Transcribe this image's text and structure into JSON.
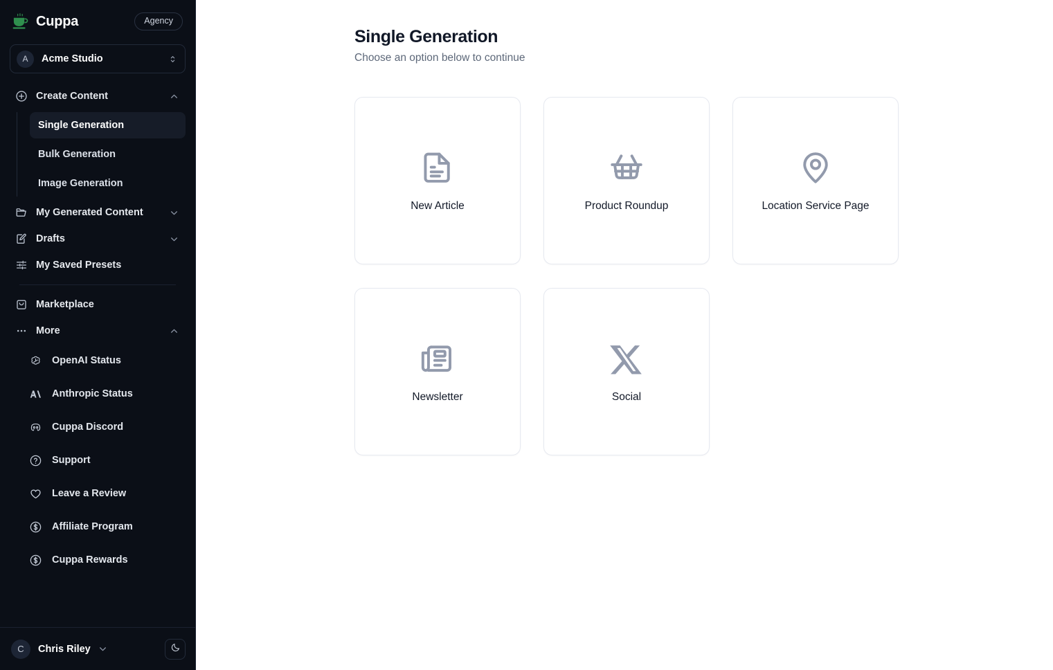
{
  "sidebar": {
    "brand": {
      "name": "Cuppa",
      "logo_icon": "coffee-cup-icon",
      "badge": "Agency",
      "accent": "#2f8f4e"
    },
    "workspace": {
      "initial": "A",
      "name": "Acme Studio",
      "chevron_icon": "chevron-up-down-icon"
    },
    "nav": [
      {
        "label": "Create Content",
        "icon": "plus-circle-icon",
        "chevron": "chevron-up-icon",
        "expanded": true,
        "children": [
          {
            "label": "Single Generation",
            "active": true
          },
          {
            "label": "Bulk Generation",
            "active": false
          },
          {
            "label": "Image Generation",
            "active": false
          }
        ]
      },
      {
        "label": "My Generated Content",
        "icon": "folder-icon",
        "chevron": "chevron-down-icon",
        "expanded": false
      },
      {
        "label": "Drafts",
        "icon": "pencil-square-icon",
        "chevron": "chevron-down-icon",
        "expanded": false
      },
      {
        "label": "My Saved Presets",
        "icon": "sliders-icon",
        "chevron": "",
        "expanded": false
      }
    ],
    "nav_after_divider": [
      {
        "label": "Marketplace",
        "icon": "shopping-bag-icon",
        "chevron": "",
        "expanded": false
      },
      {
        "label": "More",
        "icon": "ellipsis-icon",
        "chevron": "chevron-up-icon",
        "expanded": true
      }
    ],
    "more_items": [
      {
        "label": "OpenAI Status",
        "icon": "openai-icon"
      },
      {
        "label": "Anthropic Status",
        "icon": "anthropic-icon"
      },
      {
        "label": "Cuppa Discord",
        "icon": "discord-icon"
      },
      {
        "label": "Support",
        "icon": "question-circle-icon"
      },
      {
        "label": "Leave a Review",
        "icon": "heart-icon"
      },
      {
        "label": "Affiliate Program",
        "icon": "dollar-circle-icon"
      },
      {
        "label": "Cuppa Rewards",
        "icon": "dollar-circle-icon"
      }
    ],
    "footer": {
      "initial": "C",
      "name": "Chris Riley",
      "chevron_icon": "chevron-down-icon",
      "theme_icon": "moon-icon"
    }
  },
  "main": {
    "title": "Single Generation",
    "subtitle": "Choose an option below to continue",
    "cards": [
      {
        "label": "New Article",
        "icon": "document-text-icon"
      },
      {
        "label": "Product Roundup",
        "icon": "shopping-basket-icon"
      },
      {
        "label": "Location Service Page",
        "icon": "map-pin-icon"
      },
      {
        "label": "Newsletter",
        "icon": "newspaper-icon"
      },
      {
        "label": "Social",
        "icon": "x-twitter-icon"
      }
    ]
  }
}
